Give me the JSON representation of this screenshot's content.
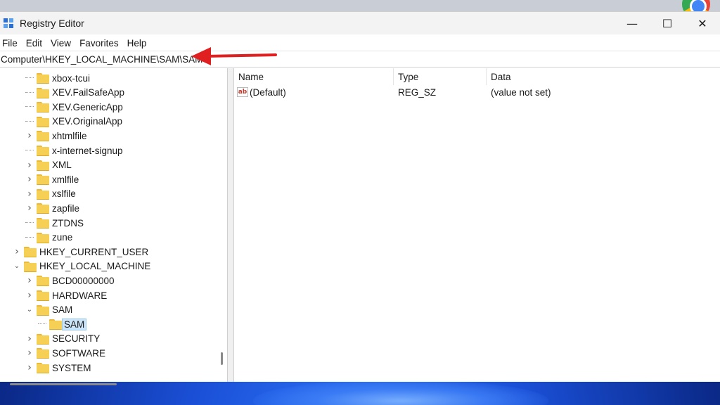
{
  "window": {
    "title": "Registry Editor",
    "controls": {
      "minimize": "—",
      "maximize": "☐",
      "close": "✕"
    }
  },
  "menu": [
    "File",
    "Edit",
    "View",
    "Favorites",
    "Help"
  ],
  "address": "Computer\\HKEY_LOCAL_MACHINE\\SAM\\SAM",
  "tree": {
    "items": [
      {
        "label": "xbox-tcui",
        "expandable": false,
        "depth": 2
      },
      {
        "label": "XEV.FailSafeApp",
        "expandable": false,
        "depth": 2
      },
      {
        "label": "XEV.GenericApp",
        "expandable": false,
        "depth": 2
      },
      {
        "label": "XEV.OriginalApp",
        "expandable": false,
        "depth": 2
      },
      {
        "label": "xhtmlfile",
        "expandable": true,
        "depth": 2
      },
      {
        "label": "x-internet-signup",
        "expandable": false,
        "depth": 2
      },
      {
        "label": "XML",
        "expandable": true,
        "depth": 2
      },
      {
        "label": "xmlfile",
        "expandable": true,
        "depth": 2
      },
      {
        "label": "xslfile",
        "expandable": true,
        "depth": 2
      },
      {
        "label": "zapfile",
        "expandable": true,
        "depth": 2
      },
      {
        "label": "ZTDNS",
        "expandable": false,
        "depth": 2
      },
      {
        "label": "zune",
        "expandable": false,
        "depth": 2
      },
      {
        "label": "HKEY_CURRENT_USER",
        "expandable": true,
        "depth": 1
      },
      {
        "label": "HKEY_LOCAL_MACHINE",
        "expandable": true,
        "expanded": true,
        "depth": 1
      },
      {
        "label": "BCD00000000",
        "expandable": true,
        "depth": 2
      },
      {
        "label": "HARDWARE",
        "expandable": true,
        "depth": 2
      },
      {
        "label": "SAM",
        "expandable": true,
        "expanded": true,
        "depth": 2
      },
      {
        "label": "SAM",
        "expandable": false,
        "selected": true,
        "depth": 3
      },
      {
        "label": "SECURITY",
        "expandable": true,
        "depth": 2
      },
      {
        "label": "SOFTWARE",
        "expandable": true,
        "depth": 2
      },
      {
        "label": "SYSTEM",
        "expandable": true,
        "depth": 2
      }
    ]
  },
  "list": {
    "columns": [
      "Name",
      "Type",
      "Data"
    ],
    "rows": [
      {
        "name": "(Default)",
        "type": "REG_SZ",
        "data": "(value not set)"
      }
    ],
    "value_icon": "ab"
  },
  "colors": {
    "accent_arrow": "#e02020",
    "selection": "#cce4f7",
    "folder": "#f6cf55"
  }
}
